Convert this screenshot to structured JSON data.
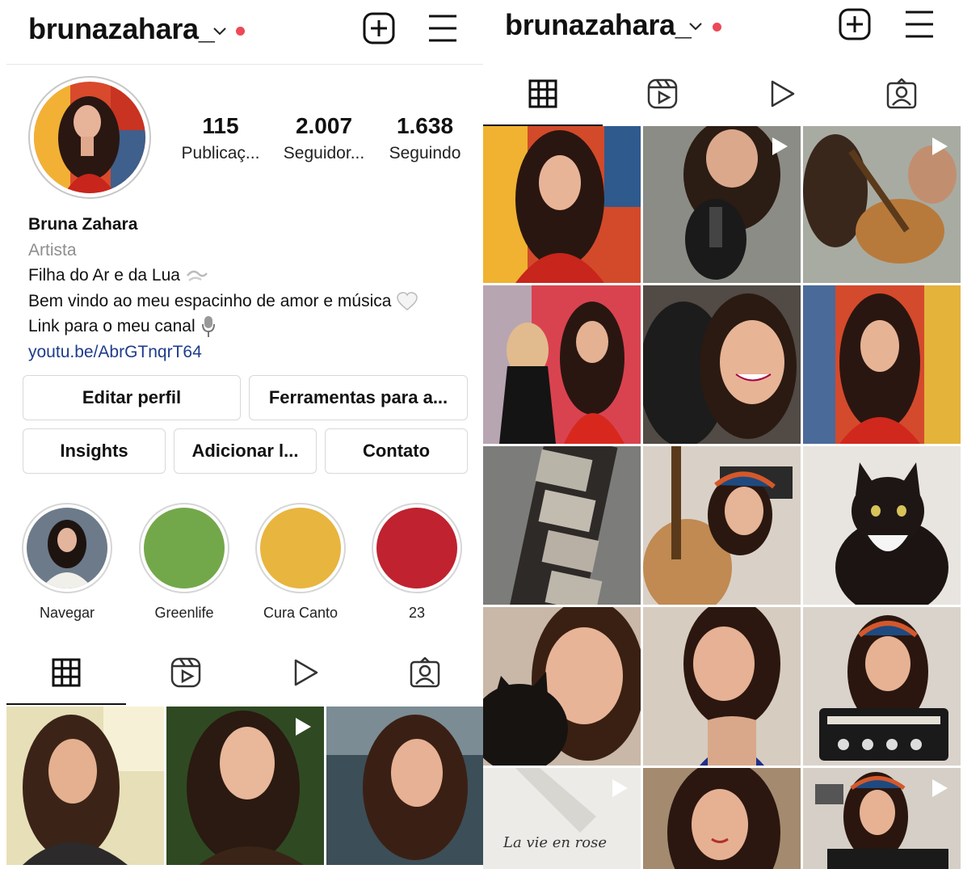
{
  "left": {
    "header": {
      "username": "bruna­zahara_"
    },
    "profile": {
      "stats": [
        {
          "value": "115",
          "label": "Publicaç..."
        },
        {
          "value": "2.007",
          "label": "Seguidor..."
        },
        {
          "value": "1.638",
          "label": "Seguindo"
        }
      ],
      "name": "Bruna Zahara",
      "category": "Artista",
      "bio_lines": [
        "Filha do Ar e da Lua",
        "Bem vindo ao meu espacinho de amor e música",
        "Link para o meu canal"
      ],
      "link": "youtu.be/AbrGTnqrT64"
    },
    "buttons": {
      "edit": "Editar perfil",
      "tools": "Ferramentas para a...",
      "insights": "Insights",
      "add": "Adicionar l...",
      "contact": "Contato"
    },
    "highlights": [
      {
        "label": "Navegar",
        "color": "#6c7a8a"
      },
      {
        "label": "Greenlife",
        "color": "#73a84a"
      },
      {
        "label": "Cura Canto",
        "color": "#e8b53e"
      },
      {
        "label": "23",
        "color": "#c0222f"
      }
    ]
  },
  "right": {
    "header": {
      "username": "bruna­zahara_"
    }
  },
  "icons": {
    "tabs": [
      "grid-icon",
      "reels-icon",
      "video-play-icon",
      "tagged-icon"
    ],
    "header": [
      "chevron-down-icon",
      "new-post-icon",
      "menu-icon"
    ]
  },
  "colors": {
    "notification_dot": "#ed4956",
    "link": "#1f3c8c",
    "category": "#8e8e8e"
  }
}
